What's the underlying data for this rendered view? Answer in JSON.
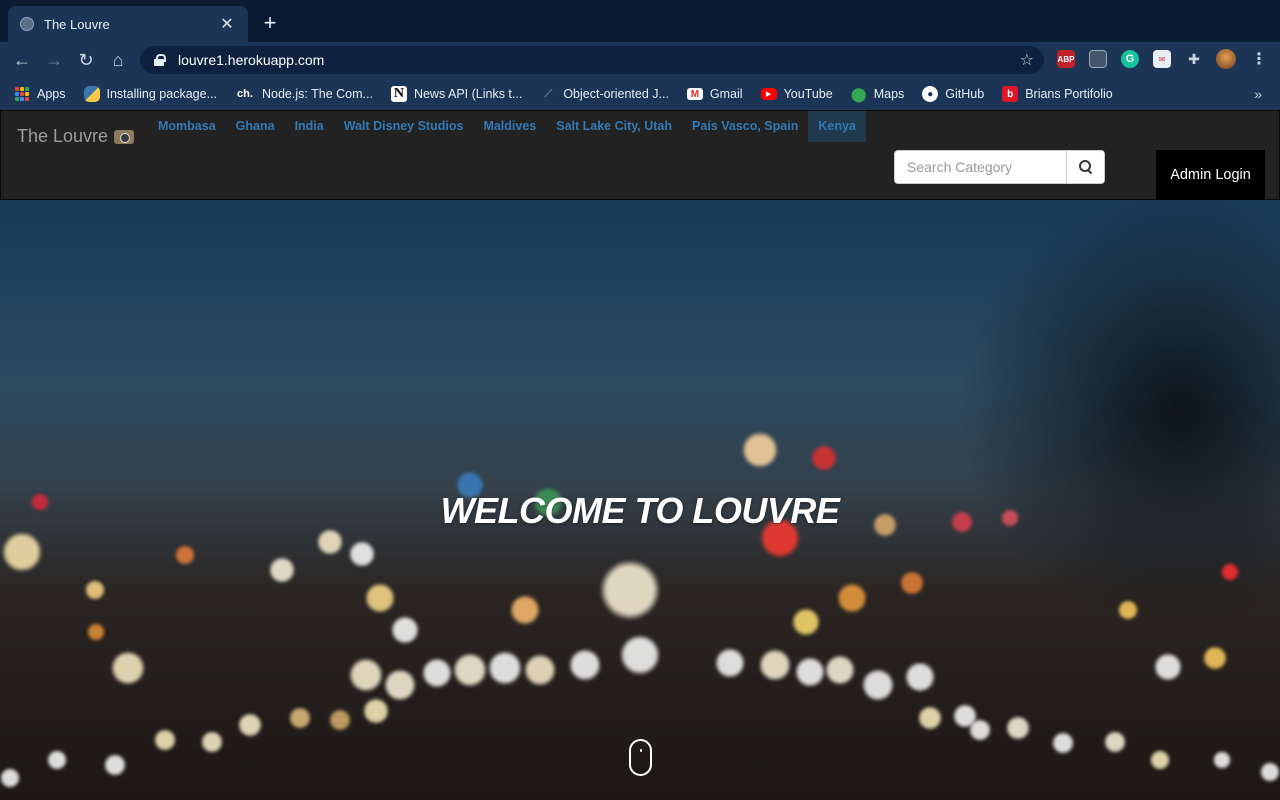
{
  "browser": {
    "tab_title": "The Louvre",
    "url": "louvre1.herokuapp.com",
    "bookmarks": [
      {
        "label": "Apps",
        "icon": "apps-grid-icon"
      },
      {
        "label": "Installing package...",
        "icon": "python-icon"
      },
      {
        "label": "Node.js: The Com...",
        "icon": "ch-icon",
        "icon_text": "ch."
      },
      {
        "label": "News API (Links t...",
        "icon": "n-logo-icon",
        "icon_text": "N"
      },
      {
        "label": "Object-oriented J...",
        "icon": "slash-icon"
      },
      {
        "label": "Gmail",
        "icon": "gmail-icon"
      },
      {
        "label": "YouTube",
        "icon": "youtube-icon"
      },
      {
        "label": "Maps",
        "icon": "maps-icon"
      },
      {
        "label": "GitHub",
        "icon": "github-icon"
      },
      {
        "label": "Brians Portifolio",
        "icon": "beats-icon"
      }
    ],
    "overflow": "»",
    "extension_abp": "ABP"
  },
  "site": {
    "brand": "The Louvre",
    "categories": [
      "Mombasa",
      "Ghana",
      "India",
      "Walt Disney Studios",
      "Maldives",
      "Salt Lake City, Utah",
      "País Vasco, Spain",
      "Kenya"
    ],
    "active_category": "Kenya",
    "search_placeholder": "Search Category",
    "admin_login": "Admin Login",
    "hero_title": "WELCOME TO LOUVRE"
  },
  "colors": {
    "chrome_dark": "#0a1a33",
    "chrome": "#1c3556",
    "navbar": "#222222",
    "link": "#337ab7"
  }
}
